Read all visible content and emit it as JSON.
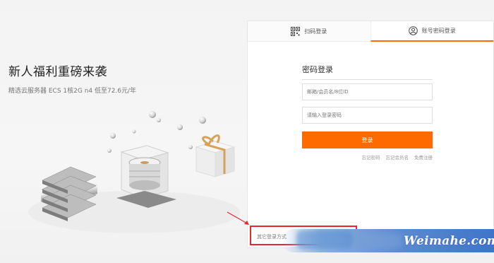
{
  "promo": {
    "title": "新人福利重磅来袭",
    "subtitle": "精选云服务器 ECS 1核2G n4 低至72.6元/年",
    "illustration_icon": "server-and-gift-illustration"
  },
  "login": {
    "tabs": [
      {
        "label": "扫码登录",
        "icon": "qr-code-icon",
        "active": false
      },
      {
        "label": "账号密码登录",
        "icon": "user-icon",
        "active": true
      }
    ],
    "form_title": "密码登录",
    "username_placeholder": "邮箱/会员名/8位ID",
    "password_placeholder": "请输入登录密码",
    "submit_label": "登录",
    "links": [
      "忘记密码",
      "忘记会员名",
      "免费注册"
    ],
    "other_login_label": "其它登录方式"
  },
  "watermark": {
    "text": "Weimahe.com"
  },
  "colors": {
    "accent": "#ff6a00",
    "annotation_red": "#e8262f",
    "banner_blue": "#3f74c9"
  }
}
